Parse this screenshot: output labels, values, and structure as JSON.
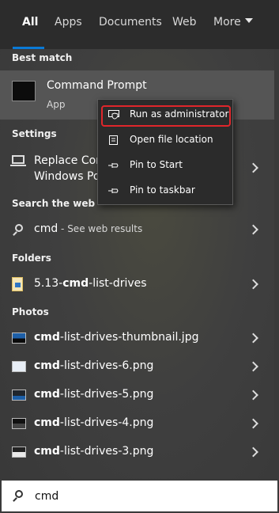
{
  "tabs": [
    "All",
    "Apps",
    "Documents",
    "Web",
    "More"
  ],
  "sections": {
    "best_match": "Best match",
    "settings": "Settings",
    "search_web": "Search the web",
    "folders": "Folders",
    "photos": "Photos"
  },
  "best_match": {
    "title": "Command Prompt",
    "subtitle": "App"
  },
  "settings_item": {
    "line1": "Replace Con",
    "line2": "Windows Po"
  },
  "web_item": {
    "query": "cmd",
    "suffix": " - See web results"
  },
  "folder_item": {
    "prefix": "5.13-",
    "bold": "cmd",
    "suffix": "-list-drives"
  },
  "photos": [
    {
      "bold": "cmd",
      "rest": "-list-drives-thumbnail.jpg"
    },
    {
      "bold": "cmd",
      "rest": "-list-drives-6.png"
    },
    {
      "bold": "cmd",
      "rest": "-list-drives-5.png"
    },
    {
      "bold": "cmd",
      "rest": "-list-drives-4.png"
    },
    {
      "bold": "cmd",
      "rest": "-list-drives-3.png"
    }
  ],
  "context_menu": [
    "Run as administrator",
    "Open file location",
    "Pin to Start",
    "Pin to taskbar"
  ],
  "search": {
    "value": "cmd"
  },
  "colors": {
    "accent": "#0a7ad6",
    "highlight_border": "#e0262b"
  },
  "icons": {
    "best_match": "command-prompt-icon",
    "settings": "monitor-icon",
    "web": "search-icon",
    "folder": "folder-icon",
    "photo": "image-icon",
    "menu": [
      "shield-icon",
      "folder-open-icon",
      "pin-icon",
      "pin-icon"
    ]
  }
}
